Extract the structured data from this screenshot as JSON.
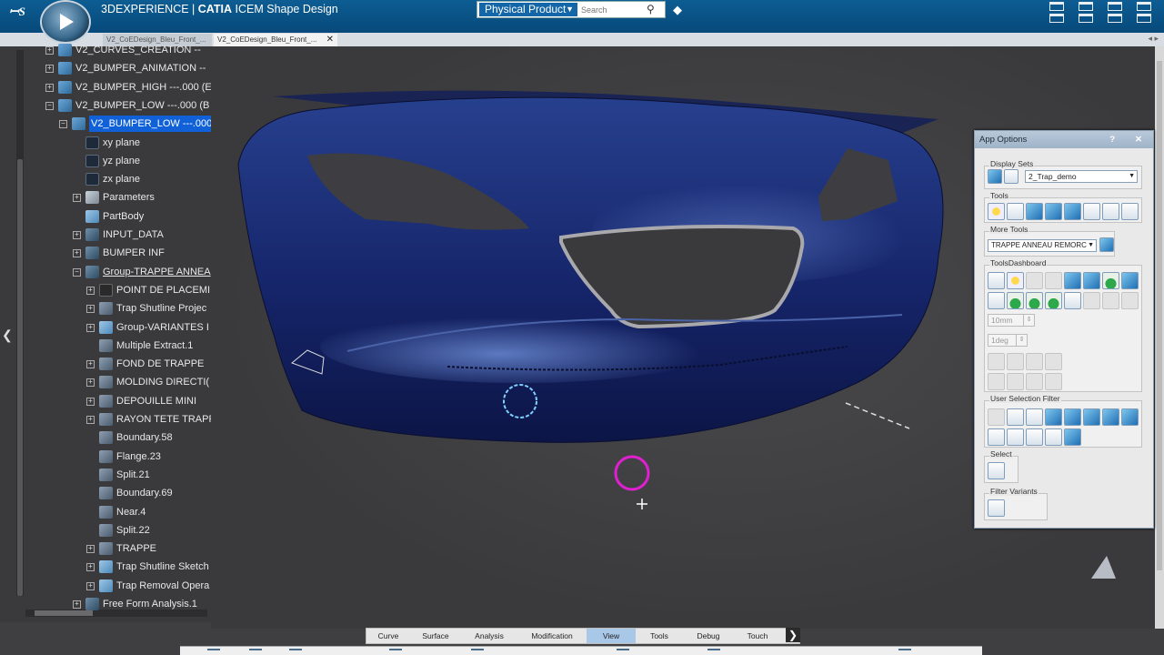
{
  "header": {
    "app_title_prefix": "3DEXPERIENCE | ",
    "app_title_brand": "CATIA",
    "app_title_suffix": " ICEM Shape Design",
    "search_scope": "Physical Product",
    "search_placeholder": "Search",
    "icons": [
      "compass-icon",
      "search-icon",
      "tag-icon"
    ]
  },
  "tabs": [
    {
      "label": "V2_CoEDesign_Bleu_Front_..."
    },
    {
      "label": "V2_CoEDesign_Bleu_Front_...",
      "active": true
    }
  ],
  "tree": {
    "nodes": [
      {
        "label": "V2_CURVES_CREATION --",
        "level": 0,
        "icon": "product"
      },
      {
        "label": "V2_BUMPER_ANIMATION --",
        "level": 0,
        "icon": "product"
      },
      {
        "label": "V2_BUMPER_HIGH ---.000 (E",
        "level": 0,
        "icon": "product"
      },
      {
        "label": "V2_BUMPER_LOW ---.000 (B",
        "level": 0,
        "icon": "product"
      },
      {
        "label": "V2_BUMPER_LOW ---.000",
        "level": 1,
        "icon": "part",
        "selected": true
      },
      {
        "label": "xy plane",
        "level": 2,
        "icon": "plane"
      },
      {
        "label": "yz plane",
        "level": 2,
        "icon": "plane"
      },
      {
        "label": "zx plane",
        "level": 2,
        "icon": "plane"
      },
      {
        "label": "Parameters",
        "level": 2,
        "icon": "gear"
      },
      {
        "label": "PartBody",
        "level": 2,
        "icon": "body"
      },
      {
        "label": "INPUT_DATA",
        "level": 2,
        "icon": "geoset"
      },
      {
        "label": "BUMPER INF",
        "level": 2,
        "icon": "geoset"
      },
      {
        "label": "Group-TRAPPE ANNEA",
        "level": 2,
        "icon": "geoset",
        "underline": true
      },
      {
        "label": "POINT DE PLACEMI",
        "level": 3,
        "icon": "dot"
      },
      {
        "label": "Trap Shutline Projec",
        "level": 3,
        "icon": "surf"
      },
      {
        "label": "Group-VARIANTES I",
        "level": 3,
        "icon": "body"
      },
      {
        "label": "Multiple Extract.1",
        "level": 3,
        "icon": "surf"
      },
      {
        "label": "FOND DE TRAPPE",
        "level": 3,
        "icon": "surf"
      },
      {
        "label": "MOLDING DIRECTI(",
        "level": 3,
        "icon": "surf"
      },
      {
        "label": "DEPOUILLE MINI",
        "level": 3,
        "icon": "surf"
      },
      {
        "label": "RAYON TETE TRAPP",
        "level": 3,
        "icon": "surf"
      },
      {
        "label": "Boundary.58",
        "level": 3,
        "icon": "surf"
      },
      {
        "label": "Flange.23",
        "level": 3,
        "icon": "surf"
      },
      {
        "label": "Split.21",
        "level": 3,
        "icon": "surf"
      },
      {
        "label": "Boundary.69",
        "level": 3,
        "icon": "surf"
      },
      {
        "label": "Near.4",
        "level": 3,
        "icon": "surf"
      },
      {
        "label": "Split.22",
        "level": 3,
        "icon": "surf"
      },
      {
        "label": "TRAPPE",
        "level": 3,
        "icon": "surf"
      },
      {
        "label": "Trap Shutline Sketch",
        "level": 3,
        "icon": "body"
      },
      {
        "label": "Trap Removal Opera",
        "level": 3,
        "icon": "body"
      },
      {
        "label": "Free Form Analysis.1",
        "level": 2,
        "icon": "geoset"
      }
    ]
  },
  "app_options": {
    "title": "App Options",
    "help": "?",
    "close": "✕",
    "display_sets_label": "Display Sets",
    "display_set_value": "2_Trap_demo",
    "tools_label": "Tools",
    "more_tools_label": "More Tools",
    "more_tools_value": "TRAPPE ANNEAU REMORC",
    "dashboard_label": "ToolsDashboard",
    "distance_value": "10mm",
    "angle_value": "1deg",
    "user_filter_label": "User Selection Filter",
    "select_label": "Select",
    "filter_variants_label": "Filter Variants"
  },
  "action_bar": {
    "sections": [
      {
        "label": "Curve"
      },
      {
        "label": "Surface"
      },
      {
        "label": "Analysis"
      },
      {
        "label": "Modification"
      },
      {
        "label": "View",
        "active": true
      },
      {
        "label": "Tools"
      },
      {
        "label": "Debug"
      },
      {
        "label": "Touch"
      }
    ],
    "more_icon": "chevron-down-icon"
  },
  "colors": {
    "accent": "#0d5d93",
    "selection": "#1061d8",
    "car_body": "#1a2a6a",
    "magenta_marker": "#e020d0",
    "cyan_marker": "#7fd0ff"
  }
}
